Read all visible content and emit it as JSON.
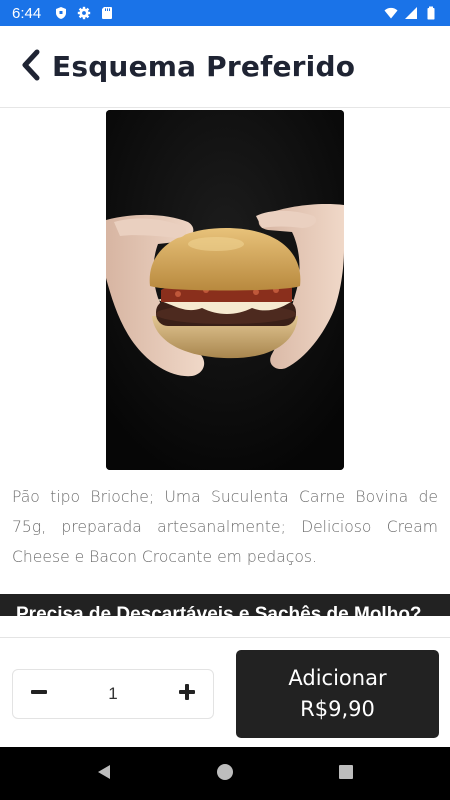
{
  "status_bar": {
    "time": "6:44",
    "icons": [
      "shield-icon",
      "gear-icon",
      "sd-card-icon",
      "wifi-icon",
      "signal-icon",
      "battery-icon"
    ]
  },
  "header": {
    "title": "Esquema Preferido",
    "back_icon": "chevron-left-icon"
  },
  "product": {
    "image_icon": "burger-photo",
    "description": "Pão tipo Brioche; Uma Suculenta Carne Bovina de 75g, preparada artesanalmente; Delicioso Cream Cheese e Bacon Crocante em pedaços."
  },
  "options": {
    "section_title": "Precisa de Descartáveis e Sachês de Molho?"
  },
  "cart": {
    "quantity": "1",
    "minus_icon": "minus-icon",
    "plus_icon": "plus-icon",
    "add_label": "Adicionar",
    "price": "R$9,90"
  },
  "nav": {
    "icons": [
      "back-triangle-icon",
      "home-circle-icon",
      "recents-square-icon"
    ]
  },
  "colors": {
    "status_bar": "#1a73e8",
    "dark": "#222222",
    "title": "#1f2433",
    "text": "#6d6d6d"
  }
}
